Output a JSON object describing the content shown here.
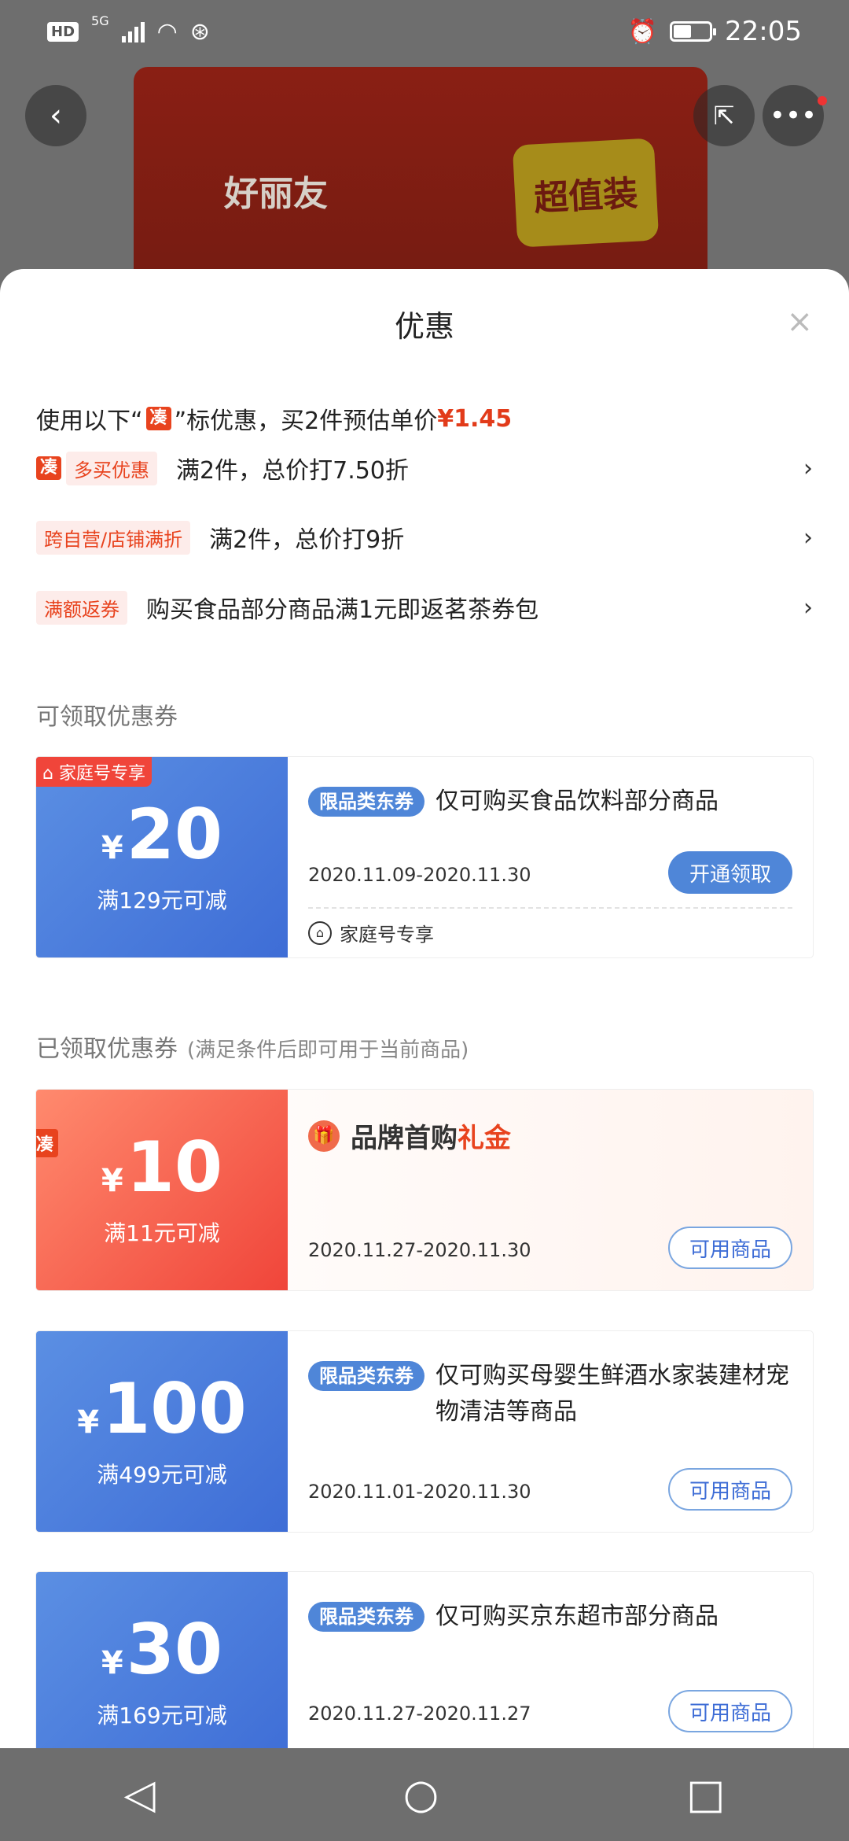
{
  "status_bar": {
    "hd": "HD",
    "network": "5G",
    "time": "22:05"
  },
  "product": {
    "brand_text": "好丽友",
    "stamp_text": "超值装"
  },
  "sheet": {
    "title": "优惠",
    "close_label": "×"
  },
  "promo": {
    "headline_prefix": "使用以下“",
    "cou_badge": "凑",
    "headline_suffix": "”标优惠，买2件预估单价",
    "price": "¥1.45",
    "rows": [
      {
        "tag": "多买优惠",
        "has_cou": true,
        "text": "满2件，总价打7.50折"
      },
      {
        "tag": "跨自营/店铺满折",
        "has_cou": false,
        "text": "满2件，总价打9折"
      },
      {
        "tag": "满额返券",
        "has_cou": false,
        "text": "购买食品部分商品满1元即返茗茶券包"
      }
    ]
  },
  "sections": {
    "available_title": "可领取优惠券",
    "claimed_title": "已领取优惠券",
    "claimed_sub": "(满足条件后即可用于当前商品)"
  },
  "coupons": [
    {
      "corner": "家庭号专享",
      "yen": "¥",
      "amount": "20",
      "condition": "满129元可减",
      "tag": "限品类东券",
      "desc": "仅可购买食品饮料部分商品",
      "date": "2020.11.09-2020.11.30",
      "button": "开通领取",
      "family_label": "家庭号专享"
    },
    {
      "corner": "凑",
      "yen": "¥",
      "amount": "10",
      "condition": "满11元可减",
      "brand_prefix": "品牌首购",
      "brand_accent": "礼金",
      "date": "2020.11.27-2020.11.30",
      "button": "可用商品"
    },
    {
      "yen": "¥",
      "amount": "100",
      "condition": "满499元可减",
      "tag": "限品类东券",
      "desc": "仅可购买母婴生鲜酒水家装建材宠物清洁等商品",
      "date": "2020.11.01-2020.11.30",
      "button": "可用商品"
    },
    {
      "yen": "¥",
      "amount": "30",
      "condition": "满169元可减",
      "tag": "限品类东券",
      "desc": "仅可购买京东超市部分商品",
      "date": "2020.11.27-2020.11.27",
      "button": "可用商品"
    }
  ],
  "icons": {
    "back": "back-icon",
    "share": "share-icon",
    "more": "more-icon",
    "close": "close-icon",
    "chevron": "chevron-right-icon",
    "home": "home-icon",
    "gift": "gift-icon",
    "nav_back": "nav-back-icon",
    "nav_home": "nav-home-icon",
    "nav_recent": "nav-recent-icon"
  },
  "colors": {
    "accent_red": "#e8431e",
    "price_red": "#e23b1a",
    "coupon_blue": "#4f86d8",
    "tag_bg": "#fdecea"
  }
}
